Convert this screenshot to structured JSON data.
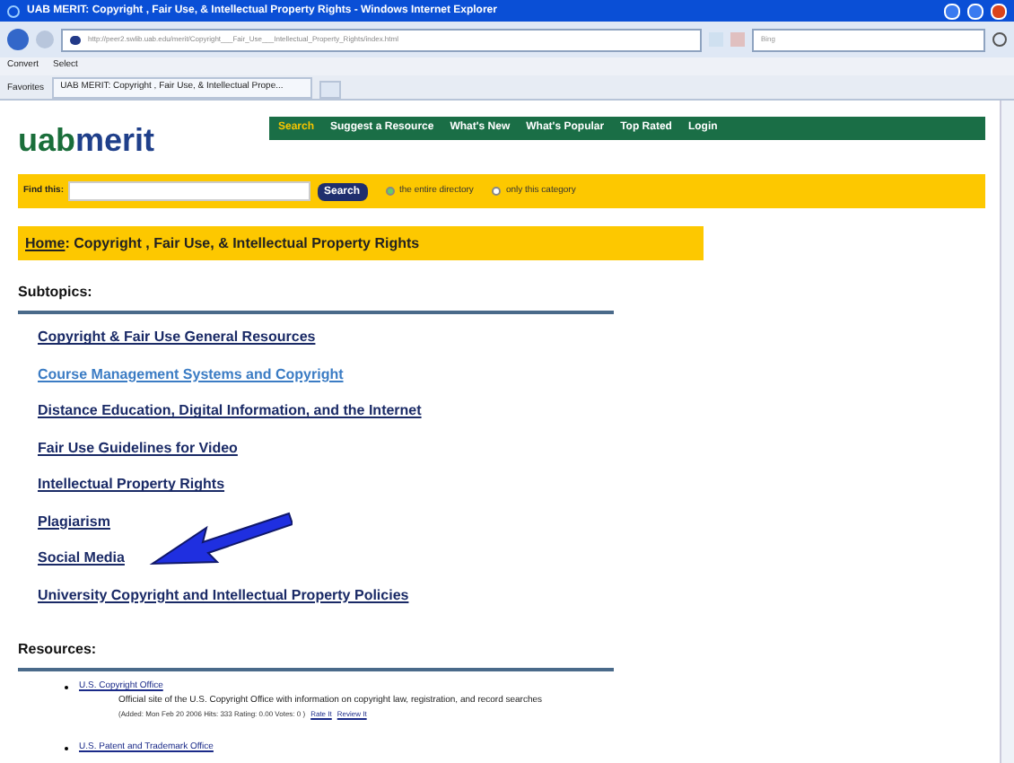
{
  "window": {
    "title": "UAB MERIT: Copyright , Fair Use, & Intellectual Property Rights - Windows Internet Explorer"
  },
  "address_bar": {
    "url": "http://peer2.swlib.uab.edu/merit/Copyright___Fair_Use___Intellectual_Property_Rights/index.html",
    "search_placeholder": "Bing"
  },
  "command_bar": {
    "items": [
      "Convert",
      "Select"
    ]
  },
  "favorites_bar": {
    "favorites": "Favorites",
    "tab": "UAB MERIT: Copyright , Fair Use, & Intellectual Prope..."
  },
  "site": {
    "logo_part1": "uab",
    "logo_part2": "merit",
    "nav": [
      {
        "label": "Search",
        "selected": true
      },
      {
        "label": "Suggest a Resource",
        "selected": false
      },
      {
        "label": "What's New",
        "selected": false
      },
      {
        "label": "What's Popular",
        "selected": false
      },
      {
        "label": "Top Rated",
        "selected": false
      },
      {
        "label": "Login",
        "selected": false
      }
    ],
    "find": {
      "label": "Find this:",
      "button": "Search",
      "scopes": [
        {
          "label": "the entire directory",
          "selected": true
        },
        {
          "label": "only this category",
          "selected": false
        }
      ]
    },
    "breadcrumb": {
      "home": "Home",
      "rest": ": Copyright , Fair Use, & Intellectual Property Rights"
    },
    "subtopics_heading": "Subtopics:",
    "subtopics": [
      {
        "label": "Copyright & Fair Use General Resources",
        "highlighted": false
      },
      {
        "label": "Course Management Systems and Copyright",
        "highlighted": true
      },
      {
        "label": "Distance Education, Digital Information, and the Internet",
        "highlighted": false
      },
      {
        "label": "Fair Use Guidelines for Video",
        "highlighted": false
      },
      {
        "label": "Intellectual Property Rights",
        "highlighted": false
      },
      {
        "label": "Plagiarism",
        "highlighted": false
      },
      {
        "label": "Social Media",
        "highlighted": false
      },
      {
        "label": "University Copyright and Intellectual Property Policies",
        "highlighted": false
      }
    ],
    "resources_heading": "Resources:",
    "resources": [
      {
        "title": "U.S. Copyright Office",
        "description": "Official site of the U.S. Copyright Office with information on copyright law, registration, and record searches",
        "meta": "(Added: Mon Feb 20 2006 Hits: 333  Rating: 0.00 Votes: 0 )",
        "rate": "Rate It",
        "review": "Review It"
      },
      {
        "title": "U.S. Patent and Trademark Office"
      }
    ]
  }
}
